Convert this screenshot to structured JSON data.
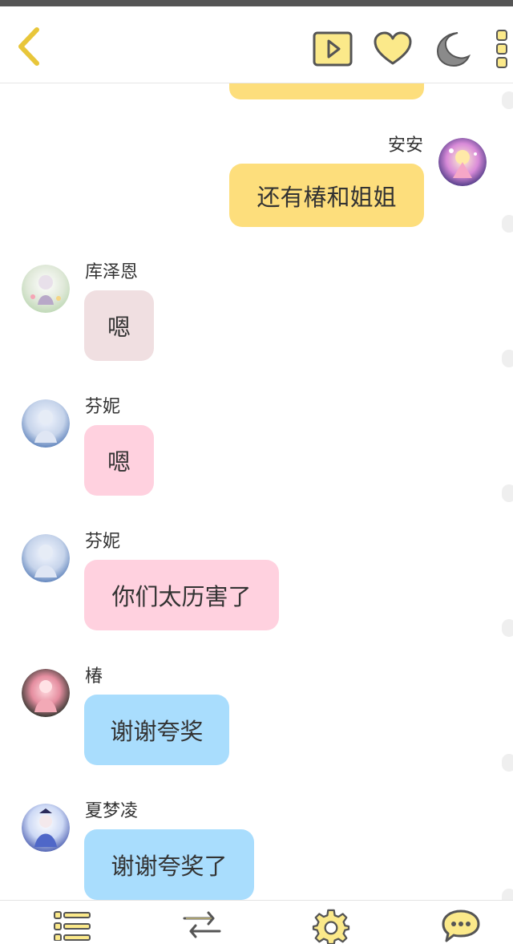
{
  "header": {
    "back_icon": "chevron-left-icon",
    "play_icon": "play-icon",
    "favorite_icon": "heart-icon",
    "night_icon": "moon-icon",
    "more_icon": "more-vertical-icon",
    "accent_color": "#e8c63a",
    "icon_fill": "#fbe98a"
  },
  "messages": [
    {
      "side": "right",
      "name": "安安",
      "text": "还有椿和姐姐",
      "bubble_color": "#fdde7c"
    },
    {
      "side": "left",
      "name": "库泽恩",
      "text": "嗯",
      "bubble_color": "#f0dfe1"
    },
    {
      "side": "left",
      "name": "芬妮",
      "text": "嗯",
      "bubble_color": "#ffd1df"
    },
    {
      "side": "left",
      "name": "芬妮",
      "text": "你们太历害了",
      "bubble_color": "#ffd1df"
    },
    {
      "side": "left",
      "name": "椿",
      "text": "谢谢夸奖",
      "bubble_color": "#a9ddfd"
    },
    {
      "side": "left",
      "name": "夏梦凌",
      "text": "谢谢夸奖了",
      "bubble_color": "#a9ddfd"
    }
  ],
  "bottom_nav": [
    {
      "icon": "list-icon"
    },
    {
      "icon": "swap-icon"
    },
    {
      "icon": "gear-icon"
    },
    {
      "icon": "chat-bubble-icon"
    }
  ]
}
